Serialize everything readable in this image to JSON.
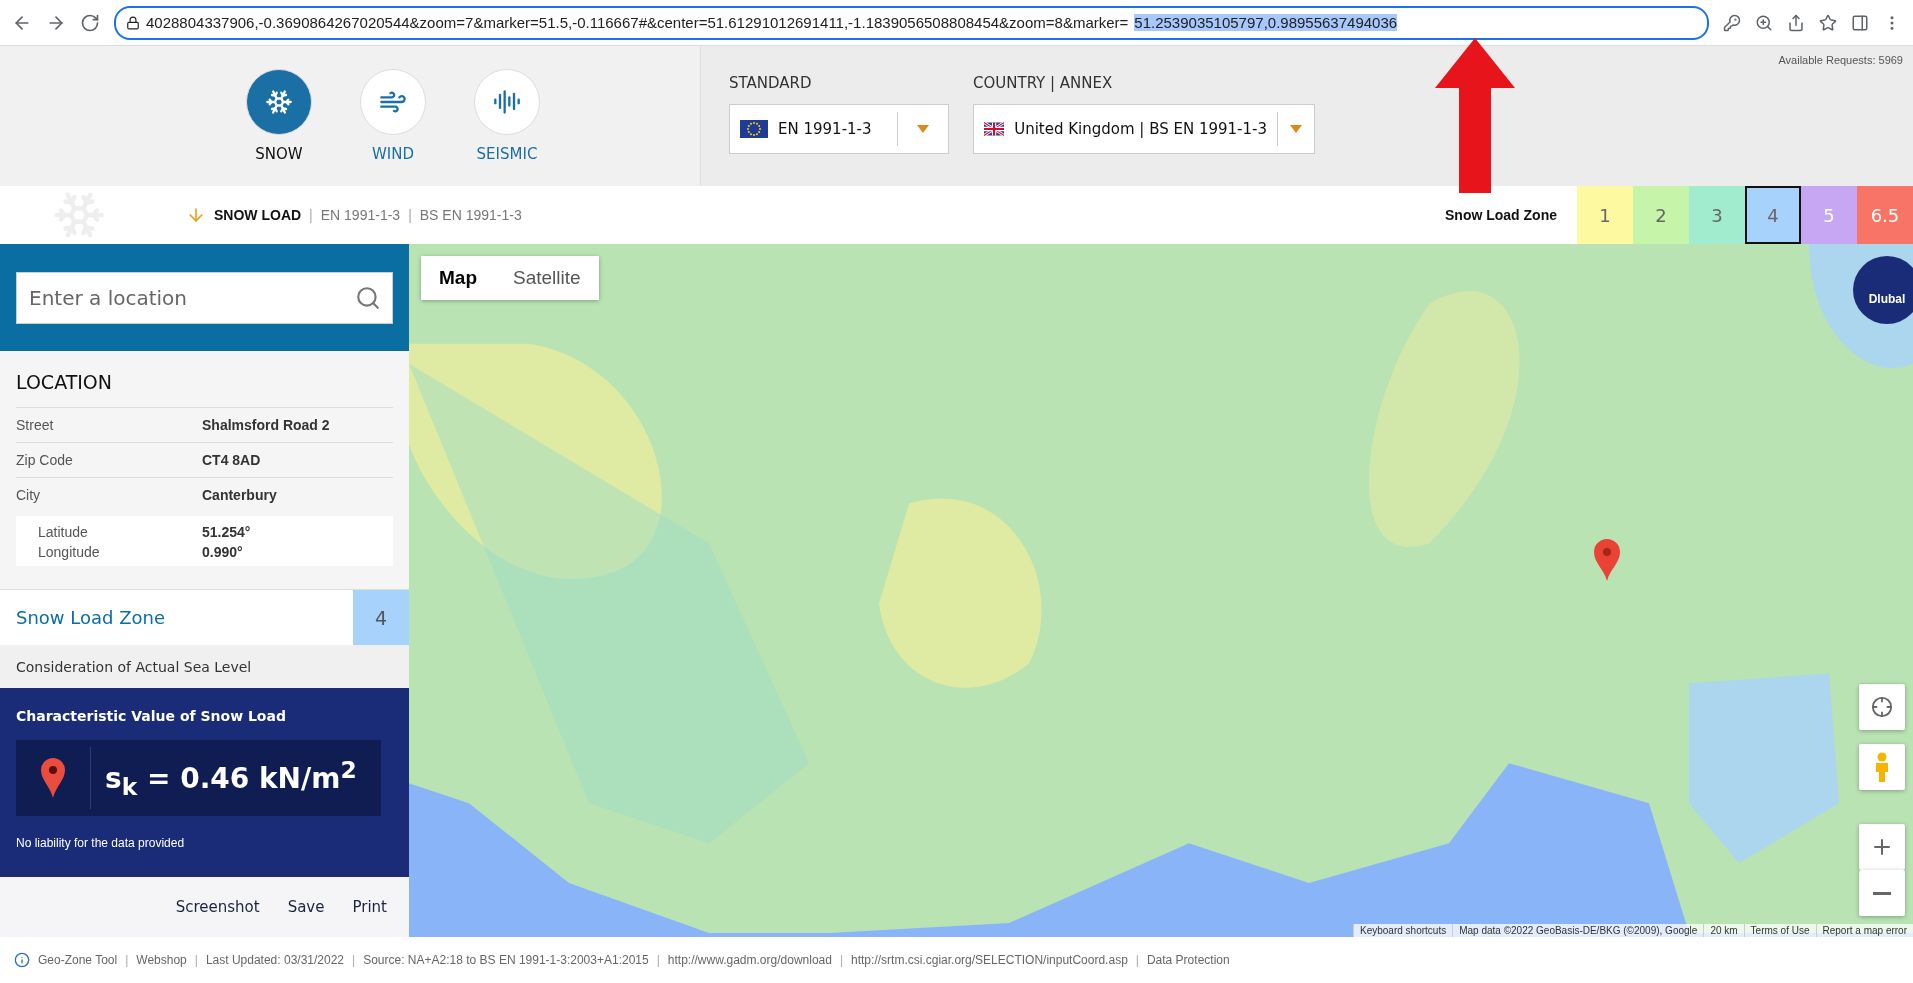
{
  "browser": {
    "url": "4028804337906,-0.3690864267020544&zoom=7&marker=51.5,-0.116667#&center=51.61291012691411,-1.1839056508808454&zoom=8&marker=",
    "url_selected": "51.2539035105797,0.98955637494036"
  },
  "load_types": [
    {
      "label": "SNOW",
      "kind": "snow",
      "selected": true
    },
    {
      "label": "WIND",
      "kind": "wind",
      "selected": false
    },
    {
      "label": "SEISMIC",
      "kind": "seismic",
      "selected": false
    }
  ],
  "standard": {
    "label": "STANDARD",
    "value": "EN 1991-1-3"
  },
  "country": {
    "label": "COUNTRY | ANNEX",
    "value": "United Kingdom | BS EN 1991-1-3"
  },
  "available_requests": "Available Requests: 5969",
  "breadcrumb": {
    "title": "SNOW LOAD",
    "items": [
      {
        "kind": "separator",
        "text": "|"
      },
      {
        "kind": "item",
        "text": "EN 1991-1-3"
      },
      {
        "kind": "separator",
        "text": "|"
      },
      {
        "kind": "item",
        "text": "BS EN 1991-1-3"
      }
    ]
  },
  "zone_legend": {
    "label": "Snow Load Zone",
    "zones": [
      {
        "label": "1",
        "color": "#fdf9a1",
        "selected": false
      },
      {
        "label": "2",
        "color": "#c6f5a9",
        "selected": false
      },
      {
        "label": "3",
        "color": "#a1ebcf",
        "selected": false
      },
      {
        "label": "4",
        "color": "#a7d2fb",
        "selected": true
      },
      {
        "label": "5",
        "color": "#c7a6f4",
        "selected": false
      },
      {
        "label": "6.5",
        "color": "#f87466",
        "selected": false
      }
    ]
  },
  "search": {
    "placeholder": "Enter a location"
  },
  "location": {
    "title": "LOCATION",
    "rows": [
      {
        "label": "Street",
        "value": "Shalmsford Road 2"
      },
      {
        "label": "Zip Code",
        "value": "CT4 8AD"
      },
      {
        "label": "City",
        "value": "Canterbury"
      }
    ],
    "coords": [
      {
        "label": "Latitude",
        "value": "51.254°"
      },
      {
        "label": "Longitude",
        "value": "0.990°"
      }
    ]
  },
  "snow_zone": {
    "label": "Snow Load Zone",
    "value": "4",
    "color": "#a7d2fb"
  },
  "sea_level": "Consideration of Actual Sea Level",
  "result": {
    "title": "Characteristic Value of Snow Load",
    "formula": "s$_{k}$ = 0.46 kN/m$^{2}$",
    "disclaimer": "No liability for the data provided"
  },
  "actions": [
    "Screenshot",
    "Save",
    "Print"
  ],
  "map": {
    "tabs": [
      {
        "label": "Map",
        "selected": true
      },
      {
        "label": "Satellite",
        "selected": false
      }
    ],
    "logo": "Dlubal",
    "attribution": [
      "Keyboard shortcuts",
      "Map data ©2022 GeoBasis-DE/BKG (©2009), Google",
      "20 km",
      "Terms of Use",
      "Report a map error"
    ]
  },
  "footer": [
    {
      "kind": "link",
      "text": "Geo-Zone Tool"
    },
    {
      "kind": "separator",
      "text": "|"
    },
    {
      "kind": "link",
      "text": "Webshop"
    },
    {
      "kind": "separator",
      "text": "|"
    },
    {
      "kind": "text",
      "text": "Last Updated: 03/31/2022"
    },
    {
      "kind": "separator",
      "text": "|"
    },
    {
      "kind": "text",
      "text": "Source: NA+A2:18 to BS EN 1991-1-3:2003+A1:2015"
    },
    {
      "kind": "separator",
      "text": "|"
    },
    {
      "kind": "link",
      "text": "http://www.gadm.org/download"
    },
    {
      "kind": "separator",
      "text": "|"
    },
    {
      "kind": "link",
      "text": "http://srtm.csi.cgiar.org/SELECTION/inputCoord.asp"
    },
    {
      "kind": "separator",
      "text": "|"
    },
    {
      "kind": "link",
      "text": "Data Protection"
    }
  ]
}
